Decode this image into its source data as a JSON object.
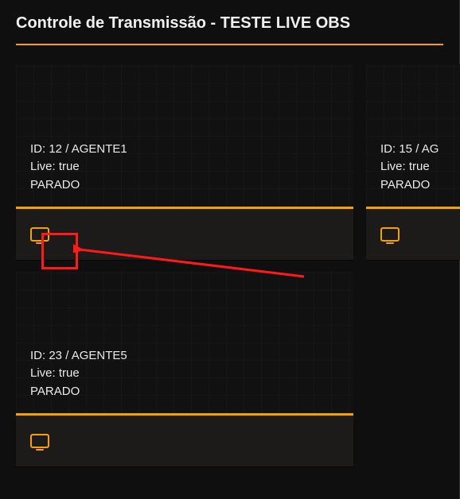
{
  "title": "Controle de Transmissão - TESTE LIVE OBS",
  "labels": {
    "id": "ID",
    "live": "Live",
    "status_stopped": "PARADO"
  },
  "cards": [
    {
      "id": "12",
      "agent": "AGENTE1",
      "live": "true",
      "status": "PARADO"
    },
    {
      "id": "15",
      "agent": "AG",
      "live": "true",
      "status": "PARADO"
    },
    {
      "id": "23",
      "agent": "AGENTE5",
      "live": "true",
      "status": "PARADO"
    }
  ],
  "accent_color": "#f5a100",
  "annotation_color": "#ff1a1a"
}
